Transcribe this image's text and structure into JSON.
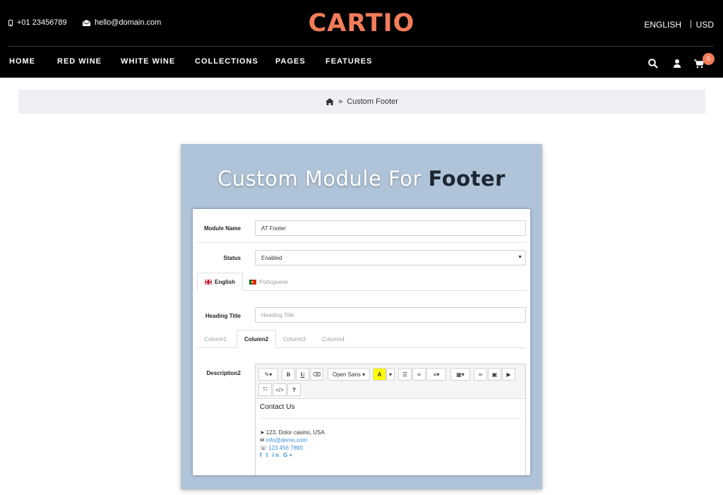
{
  "header": {
    "phone": "+01 23456789",
    "email": "hello@domain.com",
    "logo": "CARTIO",
    "language": "ENGLISH",
    "separator": "|",
    "currency": "USD",
    "nav": [
      "HOME",
      "RED WINE",
      "WHITE WINE",
      "COLLECTIONS",
      "PAGES",
      "FEATURES"
    ],
    "cart_count": "0"
  },
  "breadcrumb": {
    "separator": "»",
    "current": "Custom Footer"
  },
  "banner": {
    "title_light": "Custom Module For",
    "title_bold": "Footer"
  },
  "form": {
    "module_name_label": "Module Name",
    "module_name_value": "AT Footer",
    "status_label": "Status",
    "status_value": "Enabled",
    "lang_tabs": [
      "English",
      "Portuguese"
    ],
    "heading_title_label": "Heading Title",
    "heading_title_placeholder": "Heading Title",
    "column_tabs": [
      "Column1",
      "Column2",
      "Column3",
      "Column4"
    ],
    "description_label": "Description2"
  },
  "editor": {
    "font_name": "Open Sans",
    "content_heading": "Contact Us",
    "address": "123, Dolor casino, USA",
    "email": "info@demo.com",
    "phone": "123 456 7890",
    "social_text": "f  t  in  G+"
  },
  "colors": {
    "accent": "#f37c5a",
    "header_bg": "#000000",
    "banner_bg": "#b0c4d9",
    "link": "#3a8fd9"
  }
}
